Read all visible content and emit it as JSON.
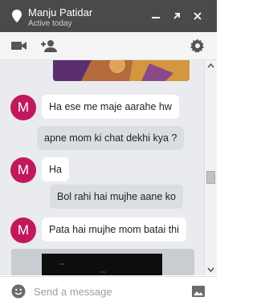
{
  "header": {
    "contact_name": "Manju Patidar",
    "status": "Active today",
    "bg_color": "#4a4a4a"
  },
  "toolbar": {
    "video_icon": "video-call-icon",
    "add_person_icon": "add-person-icon",
    "settings_icon": "gear-icon"
  },
  "messages": [
    {
      "from": "contact",
      "avatar_letter": "M",
      "text": "Ha ese me maje aarahe hw"
    },
    {
      "from": "me",
      "text": "apne mom ki chat dekhi kya ?"
    },
    {
      "from": "contact",
      "avatar_letter": "M",
      "text": "Ha"
    },
    {
      "from": "me",
      "text": "Bol rahi hai mujhe aane ko"
    },
    {
      "from": "contact",
      "avatar_letter": "M",
      "text": "Pata hai mujhe mom batai thi"
    }
  ],
  "composer": {
    "placeholder": "Send a message"
  },
  "colors": {
    "avatar": "#c2185b",
    "incoming_bubble": "#ffffff",
    "outgoing_bubble": "#dadde1",
    "thread_bg": "#e9ebee"
  }
}
